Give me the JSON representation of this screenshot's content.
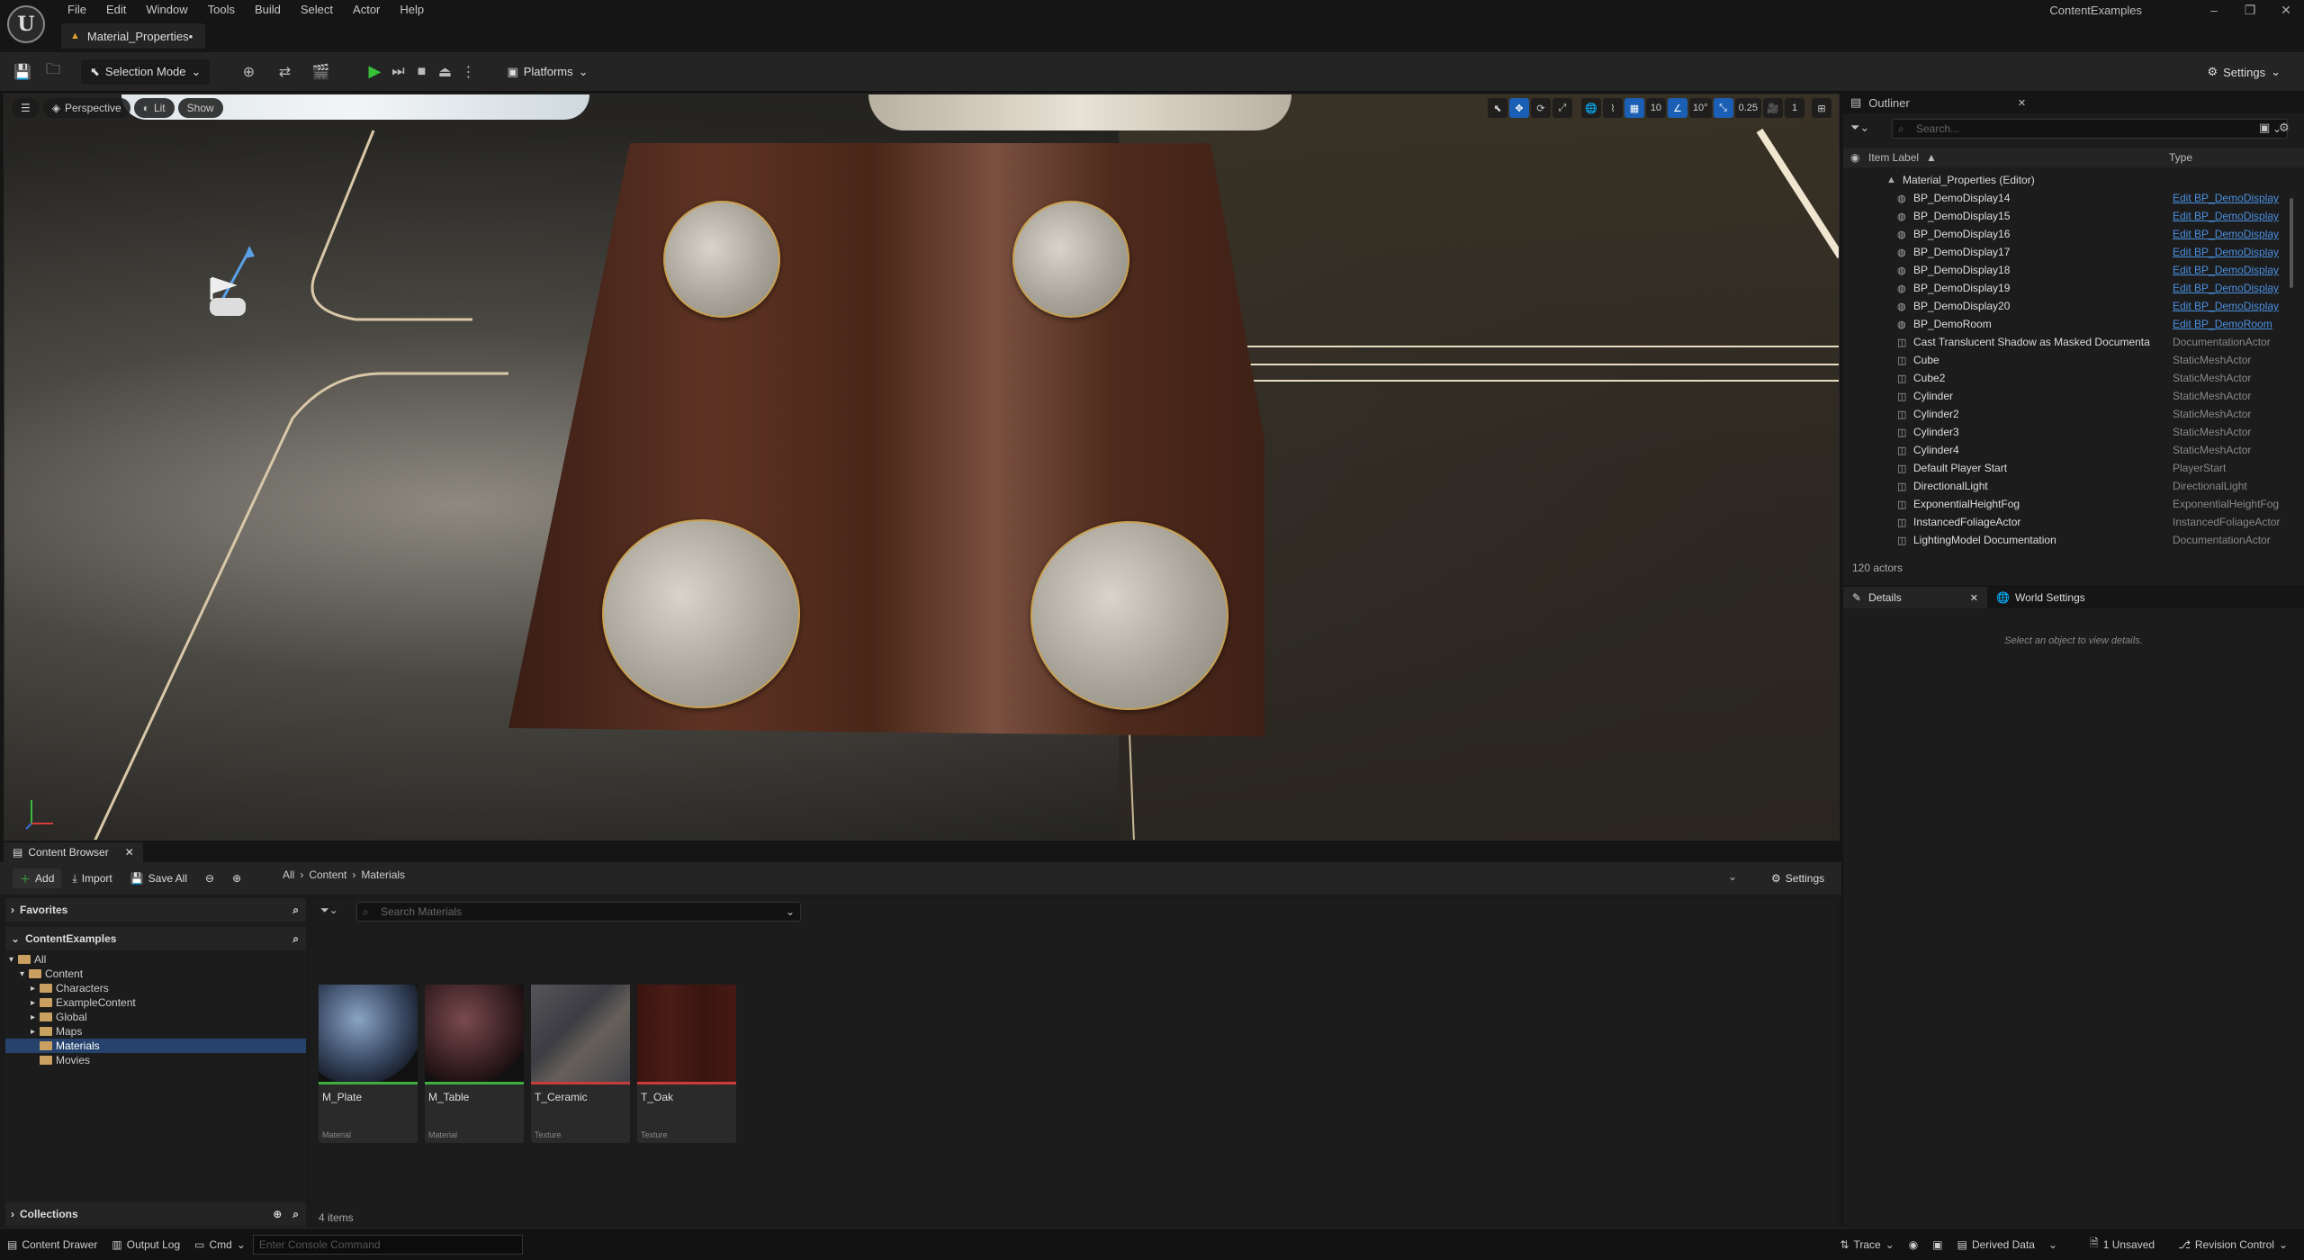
{
  "app": {
    "project_title": "ContentExamples",
    "document_tab": "Material_Properties•",
    "menu": [
      "File",
      "Edit",
      "Window",
      "Tools",
      "Build",
      "Select",
      "Actor",
      "Help"
    ]
  },
  "toolbar": {
    "selection_mode": "Selection Mode",
    "platforms": "Platforms",
    "settings": "Settings"
  },
  "viewport": {
    "perspective": "Perspective",
    "lit": "Lit",
    "show": "Show",
    "grid_snap": "10",
    "rotation_snap": "10°",
    "scale_snap": "0.25",
    "camera_speed": "1"
  },
  "content_browser": {
    "tab": "Content Browser",
    "add": "Add",
    "import": "Import",
    "save_all": "Save All",
    "breadcrumb": [
      "All",
      "Content",
      "Materials"
    ],
    "settings": "Settings",
    "favorites": "Favorites",
    "project": "ContentExamples",
    "collections": "Collections",
    "search_placeholder": "Search Materials",
    "tree": [
      {
        "label": "All",
        "depth": 0
      },
      {
        "label": "Content",
        "depth": 1
      },
      {
        "label": "Characters",
        "depth": 2
      },
      {
        "label": "ExampleContent",
        "depth": 2
      },
      {
        "label": "Global",
        "depth": 2
      },
      {
        "label": "Maps",
        "depth": 2
      },
      {
        "label": "Materials",
        "depth": 2,
        "selected": true
      },
      {
        "label": "Movies",
        "depth": 2
      }
    ],
    "assets": [
      {
        "name": "M_Plate",
        "type": "Material",
        "bar_color": "#3fae3f"
      },
      {
        "name": "M_Table",
        "type": "Material",
        "bar_color": "#3fae3f"
      },
      {
        "name": "T_Ceramic",
        "type": "Texture",
        "bar_color": "#c83c3c"
      },
      {
        "name": "T_Oak",
        "type": "Texture",
        "bar_color": "#c83c3c"
      }
    ],
    "item_count": "4 items"
  },
  "statusbar": {
    "content_drawer": "Content Drawer",
    "output_log": "Output Log",
    "cmd": "Cmd",
    "console_placeholder": "Enter Console Command",
    "trace": "Trace",
    "derived_data": "Derived Data",
    "unsaved": "1 Unsaved",
    "revision_control": "Revision Control"
  },
  "outliner": {
    "tab": "Outliner",
    "search_placeholder": "Search...",
    "col_label": "Item Label",
    "col_type": "Type",
    "root": "Material_Properties (Editor)",
    "rows": [
      {
        "label": "BP_DemoDisplay14",
        "type": "Edit BP_DemoDisplay",
        "link": true
      },
      {
        "label": "BP_DemoDisplay15",
        "type": "Edit BP_DemoDisplay",
        "link": true
      },
      {
        "label": "BP_DemoDisplay16",
        "type": "Edit BP_DemoDisplay",
        "link": true
      },
      {
        "label": "BP_DemoDisplay17",
        "type": "Edit BP_DemoDisplay",
        "link": true
      },
      {
        "label": "BP_DemoDisplay18",
        "type": "Edit BP_DemoDisplay",
        "link": true
      },
      {
        "label": "BP_DemoDisplay19",
        "type": "Edit BP_DemoDisplay",
        "link": true
      },
      {
        "label": "BP_DemoDisplay20",
        "type": "Edit BP_DemoDisplay",
        "link": true
      },
      {
        "label": "BP_DemoRoom",
        "type": "Edit BP_DemoRoom",
        "link": true
      },
      {
        "label": "Cast Translucent Shadow as Masked Documenta",
        "type": "DocumentationActor",
        "link": false
      },
      {
        "label": "Cube",
        "type": "StaticMeshActor",
        "link": false
      },
      {
        "label": "Cube2",
        "type": "StaticMeshActor",
        "link": false
      },
      {
        "label": "Cylinder",
        "type": "StaticMeshActor",
        "link": false
      },
      {
        "label": "Cylinder2",
        "type": "StaticMeshActor",
        "link": false
      },
      {
        "label": "Cylinder3",
        "type": "StaticMeshActor",
        "link": false
      },
      {
        "label": "Cylinder4",
        "type": "StaticMeshActor",
        "link": false
      },
      {
        "label": "Default Player Start",
        "type": "PlayerStart",
        "link": false
      },
      {
        "label": "DirectionalLight",
        "type": "DirectionalLight",
        "link": false
      },
      {
        "label": "ExponentialHeightFog",
        "type": "ExponentialHeightFog",
        "link": false
      },
      {
        "label": "InstancedFoliageActor",
        "type": "InstancedFoliageActor",
        "link": false
      },
      {
        "label": "LightingModel Documentation",
        "type": "DocumentationActor",
        "link": false
      }
    ],
    "actor_count": "120 actors"
  },
  "details": {
    "tab": "Details",
    "world_settings": "World Settings",
    "empty_text": "Select an object to view details."
  }
}
